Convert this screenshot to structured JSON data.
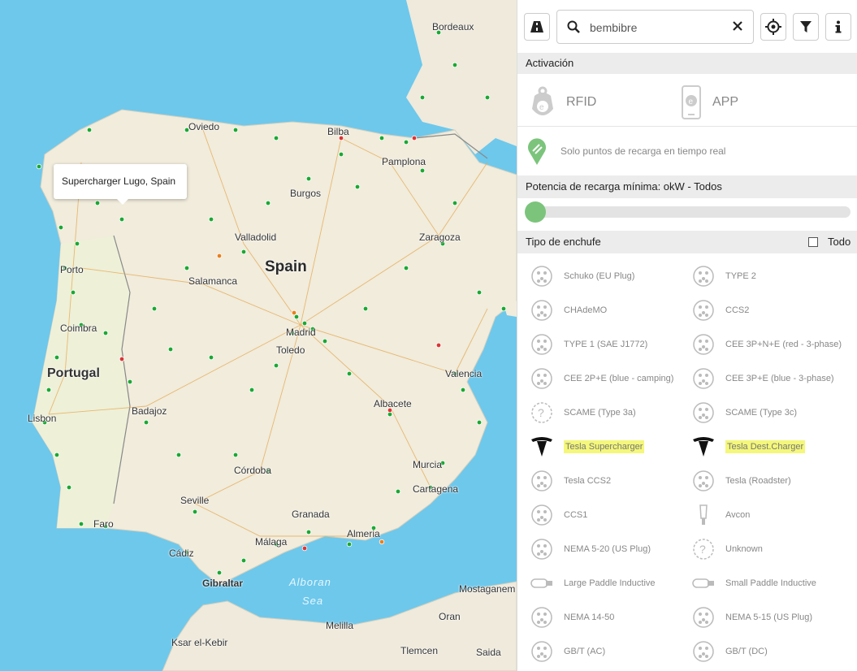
{
  "map": {
    "tooltip": "Supercharger Lugo, Spain",
    "labels": {
      "bordeaux": "Bordeaux",
      "oviedo": "Oviedo",
      "bilbao": "Bilba",
      "pamplona": "Pamplona",
      "burgos": "Burgos",
      "zaragoza": "Zaragoza",
      "valladolid": "Valladolid",
      "spain": "Spain",
      "salamanca": "Salamanca",
      "porto": "Porto",
      "coimbra": "Coimbra",
      "madrid": "Madrid",
      "toledo": "Toledo",
      "portugal": "Portugal",
      "valencia": "Valencia",
      "albacete": "Albacete",
      "badajoz": "Badajoz",
      "lisbon": "Lisbon",
      "murcia": "Murcia",
      "cordoba": "Córdoba",
      "cartagena": "Cartagena",
      "seville": "Seville",
      "granada": "Granada",
      "faro": "Faro",
      "almeria": "Almeria",
      "malaga": "Málaga",
      "cadiz": "Cádiz",
      "gibraltar": "Gibraltar",
      "alboran": "Alboran",
      "sea": "Sea",
      "mostaganem": "Mostaganem",
      "oran": "Oran",
      "melilla": "Melilla",
      "ksar": "Ksar el-Kebir",
      "tlemcen": "Tlemcen",
      "saida": "Saida"
    }
  },
  "panel": {
    "search": {
      "value": "bembibre"
    },
    "activacion": "Activación",
    "rfid": "RFID",
    "app": "APP",
    "realtime": "Solo puntos de recarga en tiempo real",
    "potencia": "Potencia de recarga mínima: okW - Todos",
    "slider_value": 0,
    "tipo_enchufe": "Tipo de enchufe",
    "todo": "Todo",
    "plugs_left": [
      {
        "label": "Schuko (EU Plug)",
        "icon": "schuko-icon",
        "highlight": false
      },
      {
        "label": "CHAdeMO",
        "icon": "chademo-icon",
        "highlight": false
      },
      {
        "label": "TYPE 1 (SAE J1772)",
        "icon": "type1-icon",
        "highlight": false
      },
      {
        "label": "CEE 2P+E (blue - camping)",
        "icon": "cee-2p-icon",
        "highlight": false
      },
      {
        "label": "SCAME (Type 3a)",
        "icon": "scame-3a-icon",
        "highlight": false
      },
      {
        "label": "Tesla Supercharger",
        "icon": "tesla-icon",
        "highlight": true
      },
      {
        "label": "Tesla CCS2",
        "icon": "tesla-ccs2-icon",
        "highlight": false
      },
      {
        "label": "CCS1",
        "icon": "ccs1-icon",
        "highlight": false
      },
      {
        "label": "NEMA 5-20 (US Plug)",
        "icon": "nema-5-20-icon",
        "highlight": false
      },
      {
        "label": "Large Paddle Inductive",
        "icon": "large-paddle-icon",
        "highlight": false
      },
      {
        "label": "NEMA 14-50",
        "icon": "nema-14-50-icon",
        "highlight": false
      },
      {
        "label": "GB/T (AC)",
        "icon": "gbt-ac-icon",
        "highlight": false
      }
    ],
    "plugs_right": [
      {
        "label": "TYPE 2",
        "icon": "type2-icon",
        "highlight": false
      },
      {
        "label": "CCS2",
        "icon": "ccs2-icon",
        "highlight": false
      },
      {
        "label": "CEE 3P+N+E (red - 3-phase)",
        "icon": "cee-3pne-icon",
        "highlight": false
      },
      {
        "label": "CEE 3P+E (blue - 3-phase)",
        "icon": "cee-3pe-icon",
        "highlight": false
      },
      {
        "label": "SCAME (Type 3c)",
        "icon": "scame-3c-icon",
        "highlight": false
      },
      {
        "label": "Tesla Dest.Charger",
        "icon": "tesla-dest-icon",
        "highlight": true
      },
      {
        "label": "Tesla (Roadster)",
        "icon": "tesla-roadster-icon",
        "highlight": false
      },
      {
        "label": "Avcon",
        "icon": "avcon-icon",
        "highlight": false
      },
      {
        "label": "Unknown",
        "icon": "unknown-icon",
        "highlight": false
      },
      {
        "label": "Small Paddle Inductive",
        "icon": "small-paddle-icon",
        "highlight": false
      },
      {
        "label": "NEMA 5-15 (US Plug)",
        "icon": "nema-5-15-icon",
        "highlight": false
      },
      {
        "label": "GB/T (DC)",
        "icon": "gbt-dc-icon",
        "highlight": false
      }
    ]
  },
  "colors": {
    "sea": "#6dc8ec",
    "land": "#f1ecdc",
    "station": "#1aa832",
    "highlight": "#f4f77a",
    "accent": "#7cc47c"
  }
}
